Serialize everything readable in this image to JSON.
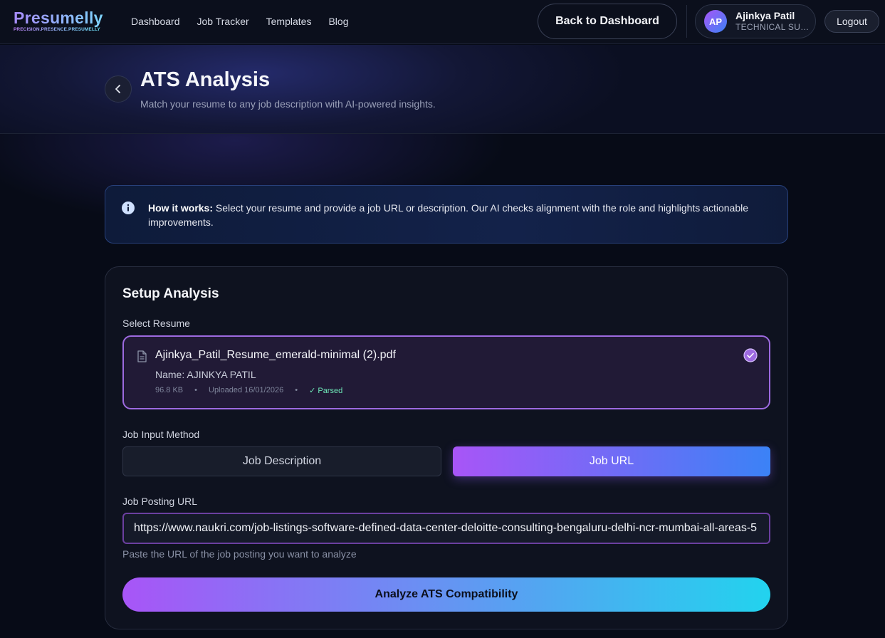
{
  "brand": {
    "name": "Presumelly",
    "tagline": "PRECISION.PRESENCE.PRESUMELLY"
  },
  "nav": {
    "items": [
      {
        "label": "Dashboard"
      },
      {
        "label": "Job Tracker"
      },
      {
        "label": "Templates"
      },
      {
        "label": "Blog"
      }
    ]
  },
  "header": {
    "back_label": "Back to Dashboard",
    "user": {
      "initials": "AP",
      "name": "Ajinkya Patil",
      "role": "TECHNICAL SUPPORT"
    },
    "logout_label": "Logout"
  },
  "page": {
    "title": "ATS Analysis",
    "subtitle": "Match your resume to any job description with AI-powered insights."
  },
  "info": {
    "bold": "How it works:",
    "text": " Select your resume and provide a job URL or description. Our AI checks alignment with the role and highlights actionable improvements."
  },
  "setup": {
    "title": "Setup Analysis",
    "resume_label": "Select Resume",
    "resume": {
      "file_name": "Ajinkya_Patil_Resume_emerald-minimal (2).pdf",
      "name_line": "Name: AJINKYA PATIL",
      "size": "96.8 KB",
      "uploaded": "Uploaded 16/01/2026",
      "status": "✓ Parsed",
      "selected": true
    },
    "method_label": "Job Input Method",
    "methods": [
      {
        "label": "Job Description",
        "active": false
      },
      {
        "label": "Job URL",
        "active": true
      }
    ],
    "url_label": "Job Posting URL",
    "url_value": "https://www.naukri.com/job-listings-software-defined-data-center-deloitte-consulting-bengaluru-delhi-ncr-mumbai-all-areas-5",
    "url_hint": "Paste the URL of the job posting you want to analyze",
    "analyze_label": "Analyze ATS Compatibility"
  },
  "colors": {
    "accent_purple": "#a855f7",
    "accent_blue": "#3b82f6",
    "accent_cyan": "#22d3ee",
    "parsed_green": "#6ee7b7",
    "background": "#070b17"
  },
  "icons": [
    "chevron-left-icon",
    "info-icon",
    "document-icon",
    "check-circle-icon"
  ]
}
